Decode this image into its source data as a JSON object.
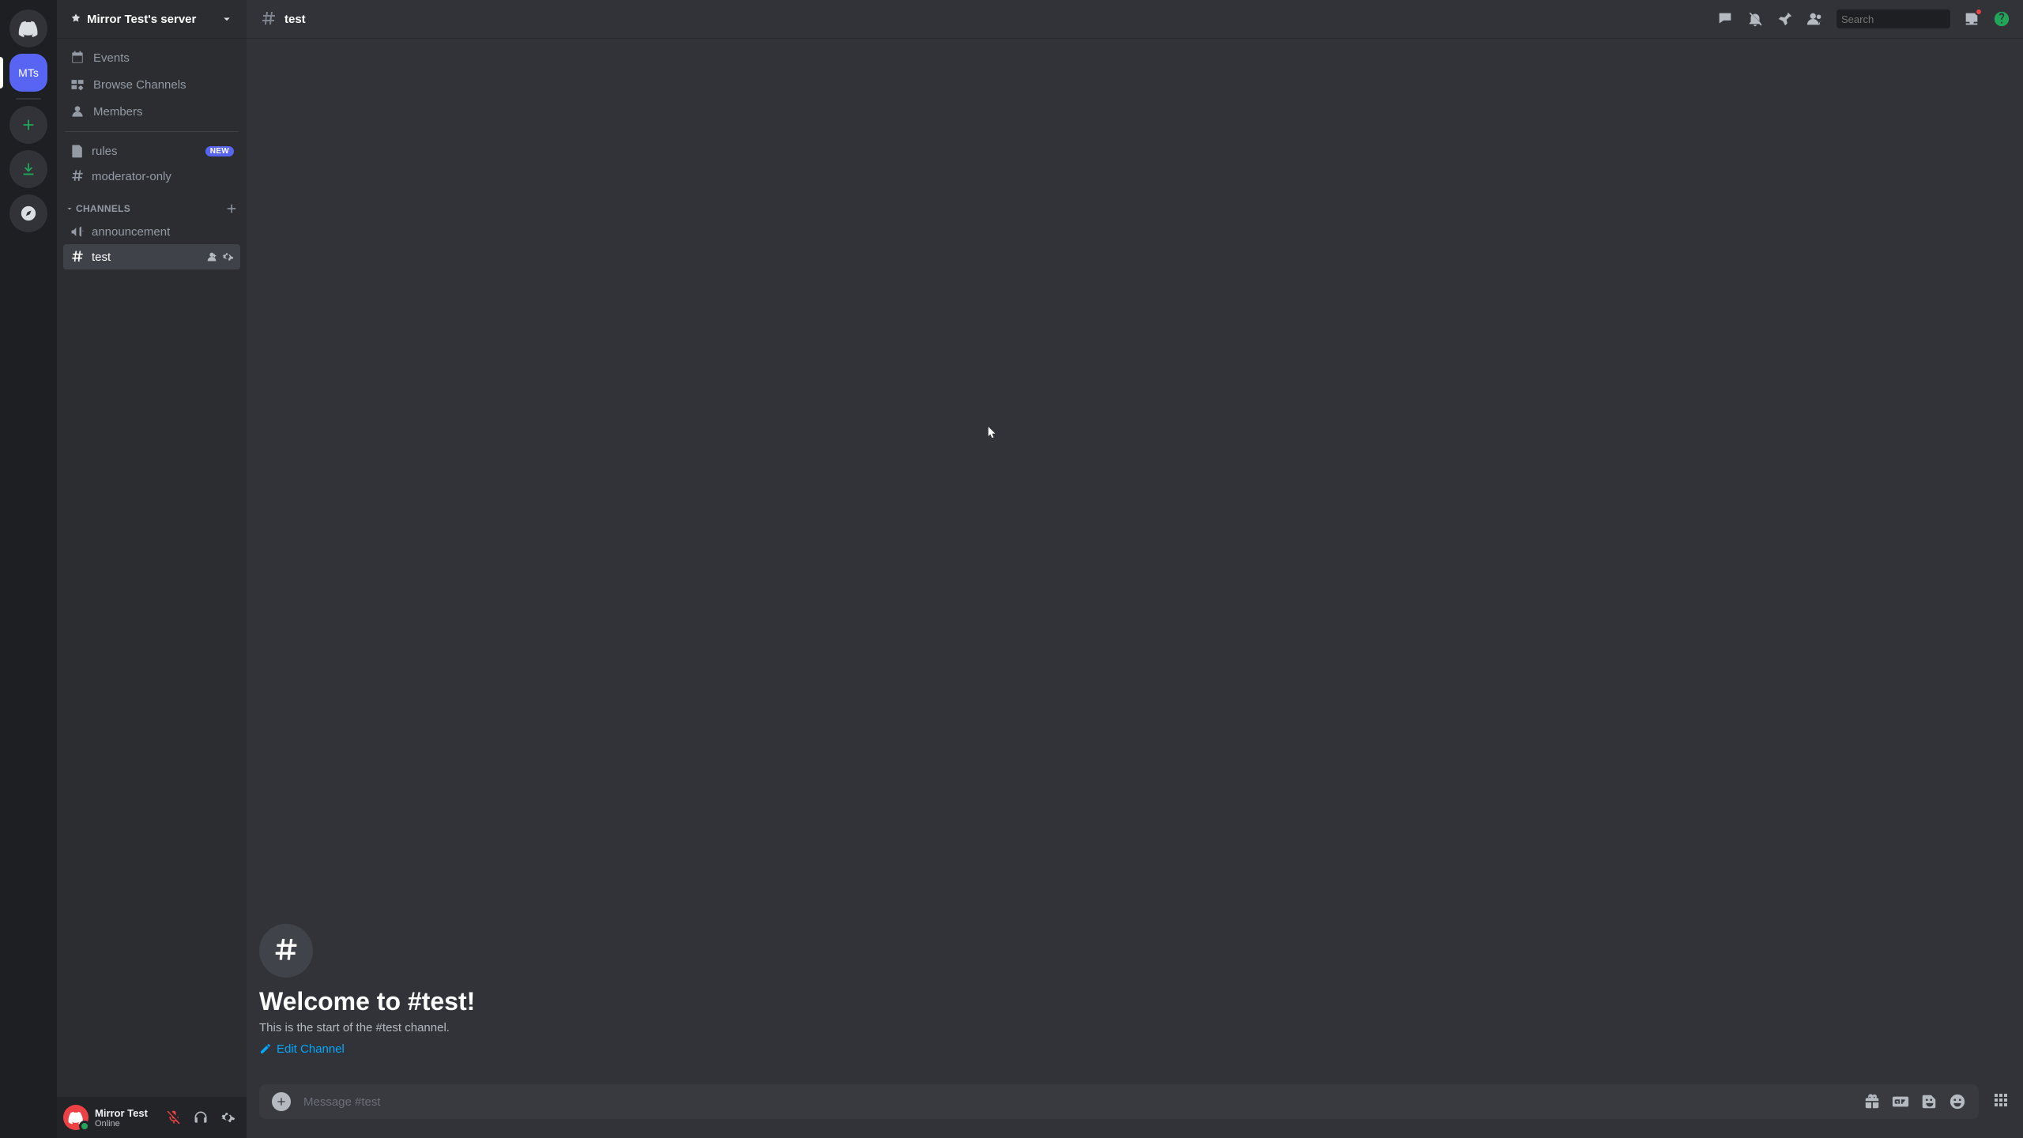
{
  "server_rail": {
    "active_server_abbr": "MTs"
  },
  "server": {
    "name": "Mirror Test's server"
  },
  "sidebar": {
    "top_links": [
      {
        "label": "Events"
      },
      {
        "label": "Browse Channels"
      },
      {
        "label": "Members"
      }
    ],
    "standalone_channels": [
      {
        "label": "rules",
        "badge": "NEW"
      },
      {
        "label": "moderator-only"
      }
    ],
    "category_label": "CHANNELS",
    "channels": [
      {
        "label": "announcement"
      },
      {
        "label": "test",
        "selected": true
      }
    ]
  },
  "user": {
    "name": "Mirror Test",
    "status": "Online"
  },
  "chat": {
    "header": {
      "channel_name": "test",
      "search_placeholder": "Search"
    },
    "empty_state": {
      "title": "Welcome to #test!",
      "subtitle": "This is the start of the #test channel.",
      "edit_link": "Edit Channel"
    },
    "compose_placeholder": "Message #test"
  }
}
